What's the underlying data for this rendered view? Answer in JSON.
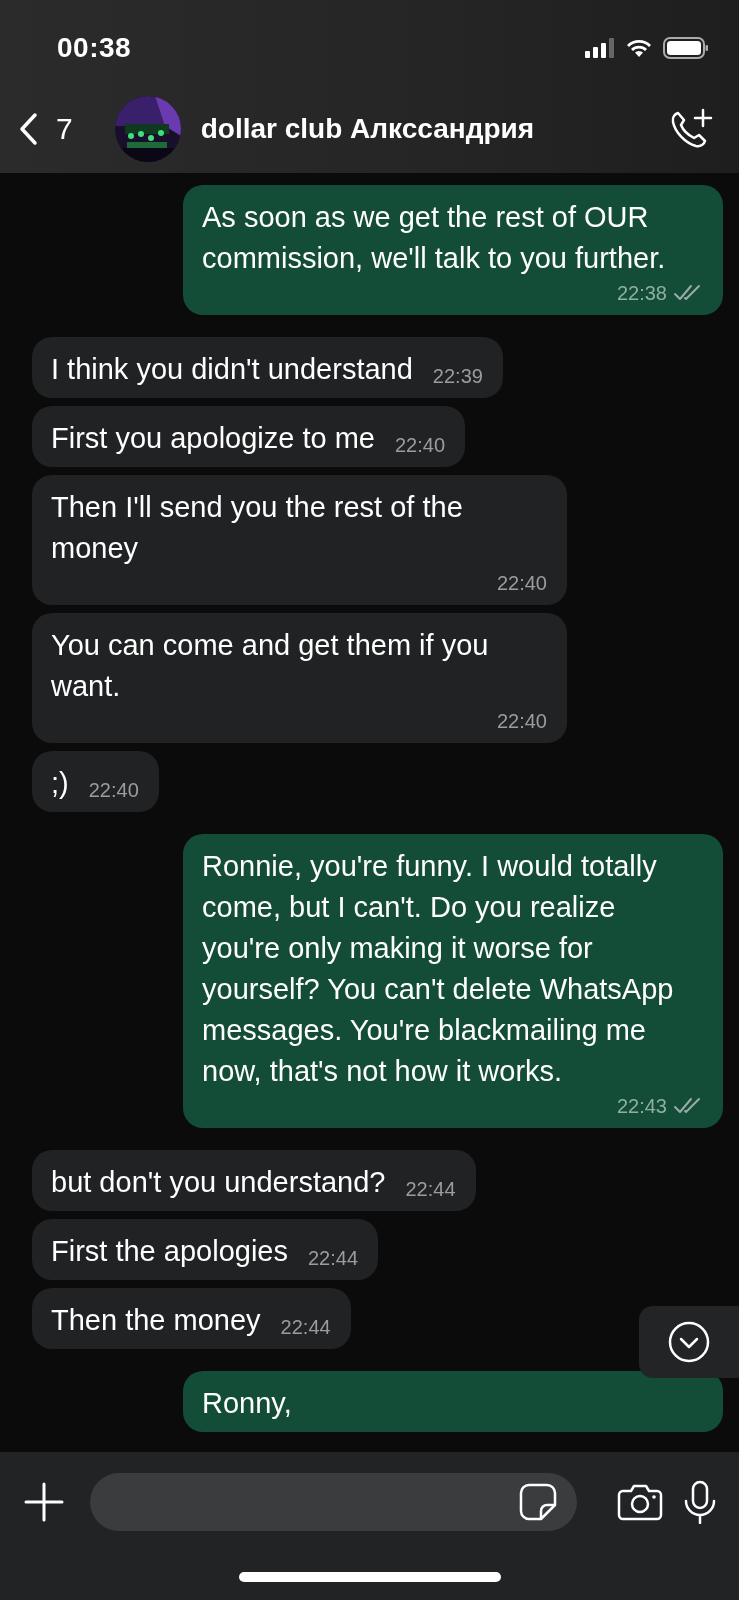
{
  "status_bar": {
    "time": "00:38"
  },
  "header": {
    "back_count": "7",
    "title": "dollar club Алкссандрия"
  },
  "messages": [
    {
      "kind": "out",
      "text": "As soon as we get the rest of OUR commission, we'll talk to you further.",
      "time": "22:38",
      "read": true
    },
    {
      "kind": "in",
      "text": "I think you didn't understand",
      "time": "22:39"
    },
    {
      "kind": "in",
      "text": "First you apologize to me",
      "time": "22:40"
    },
    {
      "kind": "in",
      "text": "Then I'll send you the rest of the money",
      "time": "22:40"
    },
    {
      "kind": "in",
      "text": "You can come and get them if you want.",
      "time": "22:40"
    },
    {
      "kind": "in",
      "text": ";)",
      "time": "22:40"
    },
    {
      "kind": "out",
      "text": "Ronnie, you're funny. I would totally come, but I can't. Do you realize you're only making it worse for yourself? You can't delete WhatsApp messages. You're blackmailing me now, that's not how it works.",
      "time": "22:43",
      "read": true
    },
    {
      "kind": "in",
      "text": "but don't you understand?",
      "time": "22:44"
    },
    {
      "kind": "in",
      "text": "First the apologies",
      "time": "22:44"
    },
    {
      "kind": "in",
      "text": "Then the money",
      "time": "22:44"
    },
    {
      "kind": "out",
      "text": "Ronny,"
    }
  ]
}
